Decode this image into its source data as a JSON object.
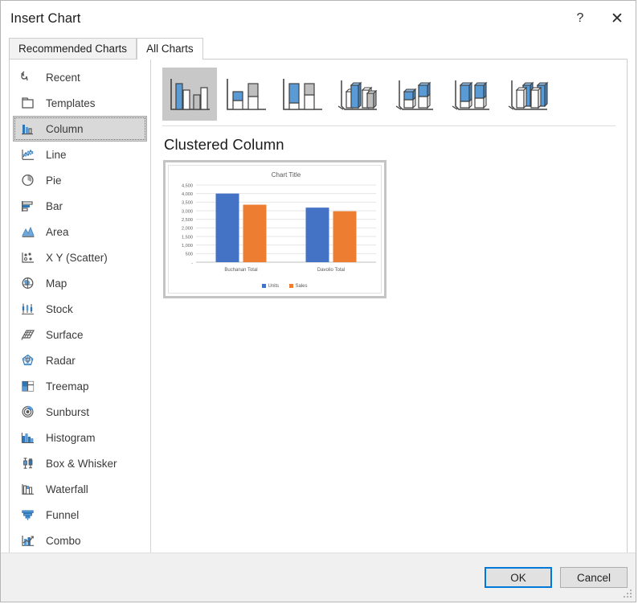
{
  "window": {
    "title": "Insert Chart",
    "help_label": "?",
    "close_label": "✕"
  },
  "tabs": [
    {
      "label": "Recommended Charts",
      "active": false
    },
    {
      "label": "All Charts",
      "active": true
    }
  ],
  "sidebar": {
    "items": [
      {
        "label": "Recent",
        "icon": "recent-icon",
        "selected": false
      },
      {
        "label": "Templates",
        "icon": "templates-icon",
        "selected": false
      },
      {
        "label": "Column",
        "icon": "column-icon",
        "selected": true
      },
      {
        "label": "Line",
        "icon": "line-icon",
        "selected": false
      },
      {
        "label": "Pie",
        "icon": "pie-icon",
        "selected": false
      },
      {
        "label": "Bar",
        "icon": "bar-icon",
        "selected": false
      },
      {
        "label": "Area",
        "icon": "area-icon",
        "selected": false
      },
      {
        "label": "X Y (Scatter)",
        "icon": "scatter-icon",
        "selected": false
      },
      {
        "label": "Map",
        "icon": "map-icon",
        "selected": false
      },
      {
        "label": "Stock",
        "icon": "stock-icon",
        "selected": false
      },
      {
        "label": "Surface",
        "icon": "surface-icon",
        "selected": false
      },
      {
        "label": "Radar",
        "icon": "radar-icon",
        "selected": false
      },
      {
        "label": "Treemap",
        "icon": "treemap-icon",
        "selected": false
      },
      {
        "label": "Sunburst",
        "icon": "sunburst-icon",
        "selected": false
      },
      {
        "label": "Histogram",
        "icon": "histogram-icon",
        "selected": false
      },
      {
        "label": "Box & Whisker",
        "icon": "box-whisker-icon",
        "selected": false
      },
      {
        "label": "Waterfall",
        "icon": "waterfall-icon",
        "selected": false
      },
      {
        "label": "Funnel",
        "icon": "funnel-icon",
        "selected": false
      },
      {
        "label": "Combo",
        "icon": "combo-icon",
        "selected": false
      }
    ]
  },
  "gallery": {
    "heading": "Clustered Column",
    "thumbnails": [
      {
        "name": "clustered-column",
        "selected": true
      },
      {
        "name": "stacked-column",
        "selected": false
      },
      {
        "name": "100-percent-stacked-column",
        "selected": false
      },
      {
        "name": "3d-clustered-column",
        "selected": false
      },
      {
        "name": "3d-stacked-column",
        "selected": false
      },
      {
        "name": "3d-100-percent-stacked-column",
        "selected": false
      },
      {
        "name": "3d-column",
        "selected": false
      }
    ]
  },
  "chart_data": {
    "type": "bar",
    "title": "Chart Title",
    "xlabel": "",
    "ylabel": "",
    "categories": [
      "Buchanan Total",
      "Davolio Total"
    ],
    "series": [
      {
        "name": "Units",
        "color": "#4472C4",
        "values": [
          4000,
          3180
        ]
      },
      {
        "name": "Sales",
        "color": "#ED7D31",
        "values": [
          3350,
          2970
        ]
      }
    ],
    "ylim": [
      0,
      4500
    ],
    "ytick_labels": [
      "4,500",
      "4,000",
      "3,500",
      "3,000",
      "2,500",
      "2,000",
      "1,500",
      "1,000",
      "500",
      "-"
    ],
    "ytick_values": [
      4500,
      4000,
      3500,
      3000,
      2500,
      2000,
      1500,
      1000,
      500,
      0
    ],
    "grid": true,
    "legend_position": "bottom"
  },
  "footer": {
    "ok_label": "OK",
    "cancel_label": "Cancel"
  },
  "colors": {
    "accent_blue": "#0078D7",
    "series_blue": "#4472C4",
    "series_orange": "#ED7D31",
    "selected_gray": "#C8C8C8"
  }
}
